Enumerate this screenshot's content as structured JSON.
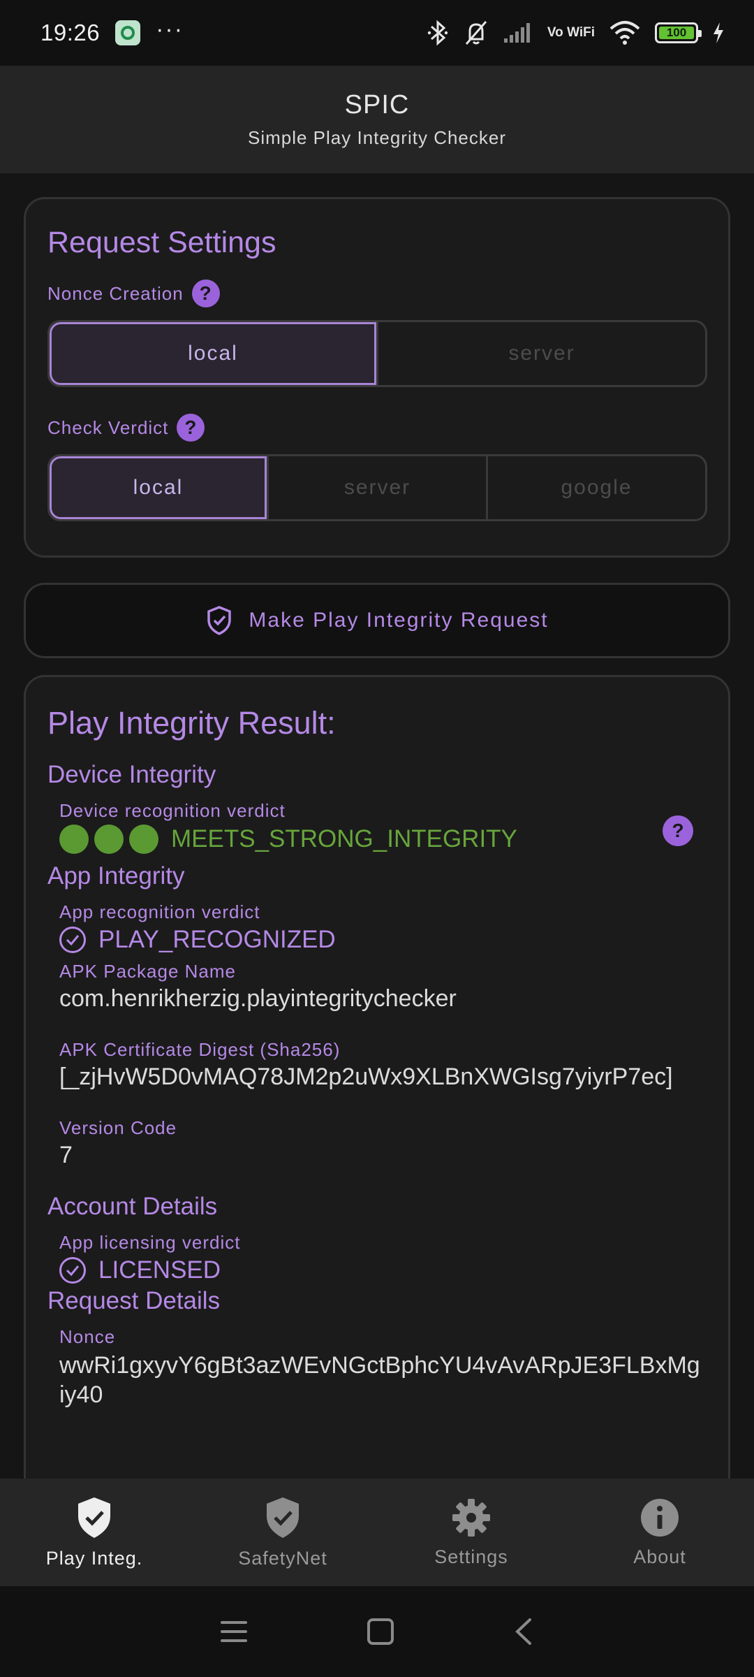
{
  "status_bar": {
    "time": "19:26",
    "more": "···",
    "network": "Vo WiFi",
    "battery": "100",
    "icons": [
      "app-notification-icon",
      "bluetooth-icon",
      "bell-off-icon",
      "signal-icon",
      "wifi-icon",
      "battery-icon",
      "charging-icon"
    ]
  },
  "app_bar": {
    "title": "SPIC",
    "subtitle": "Simple Play Integrity Checker"
  },
  "request_settings": {
    "title": "Request Settings",
    "nonce_label": "Nonce Creation",
    "nonce_options": [
      "local",
      "server"
    ],
    "nonce_selected": "local",
    "verdict_label": "Check Verdict",
    "verdict_options": [
      "local",
      "server",
      "google"
    ],
    "verdict_selected": "local",
    "help_glyph": "?"
  },
  "action": {
    "label": "Make Play Integrity Request",
    "icon": "shield-check-icon"
  },
  "result": {
    "title": "Play Integrity Result:",
    "device_integrity": {
      "title": "Device Integrity",
      "label": "Device recognition verdict",
      "value": "MEETS_STRONG_INTEGRITY",
      "level_dots": 3,
      "color": "#67a63b"
    },
    "app_integrity": {
      "title": "App Integrity",
      "recognition_label": "App recognition verdict",
      "recognition_value": "PLAY_RECOGNIZED",
      "package_label": "APK Package Name",
      "package_value": "com.henrikherzig.playintegritychecker",
      "digest_label": "APK Certificate Digest (Sha256)",
      "digest_value": "[_zjHvW5D0vMAQ78JM2p2uWx9XLBnXWGIsg7yiyrP7ec]",
      "version_label": "Version Code",
      "version_value": "7"
    },
    "account_details": {
      "title": "Account Details",
      "label": "App licensing verdict",
      "value": "LICENSED"
    },
    "request_details": {
      "title": "Request Details",
      "nonce_label": "Nonce",
      "nonce_value": "wwRi1gxyvY6gBt3azWEvNGctBphcYU4vAvARpJE3FLBxMgiy40"
    }
  },
  "bottom_nav": {
    "items": [
      {
        "label": "Play Integ.",
        "icon": "shield-check-icon",
        "active": true
      },
      {
        "label": "SafetyNet",
        "icon": "shield-check-icon",
        "active": false
      },
      {
        "label": "Settings",
        "icon": "gear-icon",
        "active": false
      },
      {
        "label": "About",
        "icon": "info-icon",
        "active": false
      }
    ]
  },
  "colors": {
    "accent": "#b589e6",
    "success": "#67a63b",
    "background": "#151515",
    "card": "#1b1b1b"
  }
}
